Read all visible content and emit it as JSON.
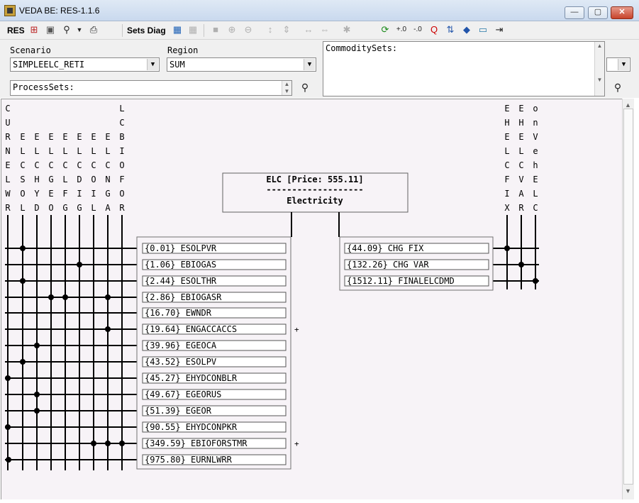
{
  "window": {
    "title": "VEDA BE: RES-1.1.6",
    "min_label": "—",
    "max_label": "▢",
    "close_label": "✕"
  },
  "toolbar": {
    "res_label": "RES",
    "sets_diag_label": "Sets Diag"
  },
  "query": {
    "scenario_label": "Scenario",
    "scenario_value": "SIMPLEELC_RETI",
    "region_label": "Region",
    "region_value": "SUM",
    "processsets_label": "ProcessSets:",
    "commoditysets_label": "CommoditySets:"
  },
  "diagram": {
    "commodity_line1": "ELC [Price: 555.11]",
    "commodity_divider": "-------------------",
    "commodity_line2": "Electricity",
    "input_commodities": [
      "ELCURNELWR",
      "ELCSOL",
      "ELCHYD",
      "ELCGEO",
      "ELCLFG",
      "ELCDIG",
      "ELCOIL",
      "ELCNGA",
      "ELCBIOFOR"
    ],
    "output_commodities": [
      "VEHELCFIX",
      "VEHELCVAR",
      "NonVehELC"
    ],
    "input_processes": [
      {
        "label": "{0.01} ESOLPVR",
        "plus": ""
      },
      {
        "label": "{1.06} EBIOGAS",
        "plus": ""
      },
      {
        "label": "{2.44} ESOLTHR",
        "plus": ""
      },
      {
        "label": "{2.86} EBIOGASR",
        "plus": ""
      },
      {
        "label": "{16.70} EWNDR",
        "plus": ""
      },
      {
        "label": "{19.64} ENGACCACCS",
        "plus": "+"
      },
      {
        "label": "{39.96} EGEOCA",
        "plus": ""
      },
      {
        "label": "{43.52} ESOLPV",
        "plus": ""
      },
      {
        "label": "{45.27} EHYDCONBLR",
        "plus": ""
      },
      {
        "label": "{49.67} EGEORUS",
        "plus": ""
      },
      {
        "label": "{51.39} EGEOR",
        "plus": ""
      },
      {
        "label": "{90.55} EHYDCONPKR",
        "plus": ""
      },
      {
        "label": "{349.59} EBIOFORSTMR",
        "plus": "+"
      },
      {
        "label": "{975.80} EURNLWRR",
        "plus": ""
      }
    ],
    "output_processes": [
      {
        "label": "{44.09} CHG FIX"
      },
      {
        "label": "{132.26} CHG VAR"
      },
      {
        "label": "{1512.11} FINALELCDMD"
      }
    ],
    "input_links": [
      [
        1,
        0
      ],
      [
        5,
        1
      ],
      [
        1,
        2
      ],
      [
        3,
        3
      ],
      [
        4,
        3
      ],
      [
        7,
        3
      ],
      [
        7,
        5
      ],
      [
        2,
        6
      ],
      [
        1,
        7
      ],
      [
        0,
        8
      ],
      [
        2,
        9
      ],
      [
        2,
        10
      ],
      [
        0,
        11
      ],
      [
        6,
        12
      ],
      [
        7,
        12
      ],
      [
        8,
        12
      ],
      [
        -1,
        13
      ]
    ],
    "output_links": [
      [
        0,
        0
      ],
      [
        1,
        1
      ],
      [
        2,
        2
      ]
    ]
  }
}
